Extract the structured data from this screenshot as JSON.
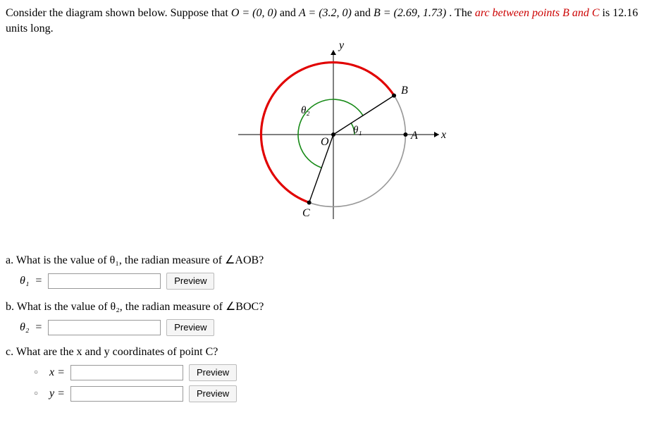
{
  "problem": {
    "prefix": "Consider the diagram shown below. Suppose that ",
    "O_eq": "O = (0, 0)",
    "and1": " and ",
    "A_eq": "A = (3.2, 0)",
    "and2": " and ",
    "B_eq": "B = (2.69, 1.73)",
    "period": ". The ",
    "arc_phrase": "arc between points B and C",
    "arc_tail": " is 12.16 units long."
  },
  "diagram": {
    "labels": {
      "y": "y",
      "x": "x",
      "O": "O",
      "A": "A",
      "B": "B",
      "C": "C",
      "theta1": "θ₁",
      "theta2": "θ₂"
    },
    "geom": {
      "O": [
        0,
        0
      ],
      "A": [
        3.2,
        0
      ],
      "B": [
        2.69,
        1.73
      ],
      "radius": 3.2,
      "arc_BC_length": 12.16,
      "C_angle_deg": 250.4
    }
  },
  "parts": {
    "a": {
      "text": "a. What is the value of θ₁, the radian measure of ∠AOB?",
      "label": "θ₁  =",
      "preview": "Preview"
    },
    "b": {
      "text": "b. What is the value of θ₂, the radian measure of ∠BOC?",
      "label": "θ₂  =",
      "preview": "Preview"
    },
    "c": {
      "text": "c. What are the x and y coordinates of point C?",
      "x_label": "x =",
      "y_label": "y =",
      "preview_x": "Preview",
      "preview_y": "Preview"
    }
  },
  "chart_data": {
    "type": "diagram",
    "title": "Circle with center O, points A and B on circle, arc BC marked",
    "O": [
      0,
      0
    ],
    "A": [
      3.2,
      0
    ],
    "B": [
      2.69,
      1.73
    ],
    "radius": 3.2,
    "arc_BC_length_units": 12.16,
    "theta1_desc": "angle AOB in radians",
    "theta2_desc": "angle BOC in radians",
    "axes": [
      "x",
      "y"
    ]
  }
}
